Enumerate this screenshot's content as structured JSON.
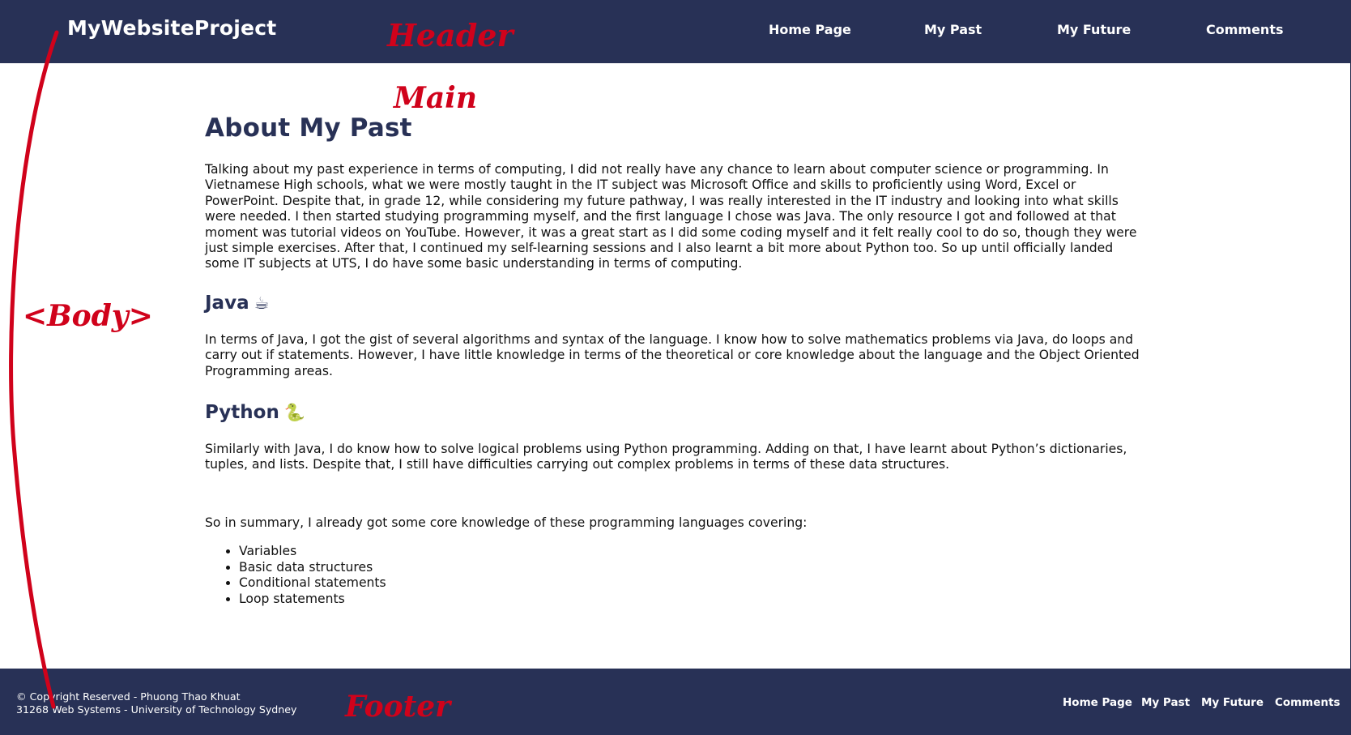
{
  "colors": {
    "header_bg": "#283156",
    "heading": "#283156",
    "annotation": "#d0021b",
    "body_text": "#111111"
  },
  "header": {
    "site_title": "MyWebsiteProject",
    "nav": [
      "Home Page",
      "My Past",
      "My Future",
      "Comments"
    ]
  },
  "main": {
    "title": "About My Past",
    "intro": "Talking about my past experience in terms of computing, I did not really have any chance to learn about computer science or programming. In Vietnamese High schools, what we were mostly taught in the IT subject was Microsoft Office and skills to proficiently using Word, Excel or PowerPoint. Despite that, in grade 12, while considering my future pathway, I was really interested in the IT industry and looking into what skills were needed. I then started studying programming myself, and the first language I chose was Java. The only resource I got and followed at that moment was tutorial videos on YouTube. However, it was a great start as I did some coding myself and it felt really cool to do so, though they were just simple exercises. After that, I continued my self-learning sessions and I also learnt a bit more about Python too. So up until officially landed some IT subjects at UTS, I do have some basic understanding in terms of computing.",
    "java": {
      "heading": "Java",
      "emoji": "☕",
      "text": "In terms of Java, I got the gist of several algorithms and syntax of the language. I know how to solve mathematics problems via Java, do loops and carry out if statements. However, I have little knowledge in terms of the theoretical or core knowledge about the language and the Object Oriented Programming areas."
    },
    "python": {
      "heading": "Python",
      "emoji": "🐍",
      "text": "Similarly with Java, I do know how to solve logical problems using Python programming. Adding on that, I have learnt about Python’s dictionaries, tuples, and lists. Despite that, I still have difficulties carrying out complex problems in terms of these data structures."
    },
    "summary": "So in summary, I already got some core knowledge of these programming languages covering:",
    "list": [
      "Variables",
      "Basic data structures",
      "Conditional statements",
      "Loop statements"
    ]
  },
  "footer": {
    "copyright_line1": "© Copyright Reserved - Phuong Thao Khuat",
    "copyright_line2": "31268 Web Systems - University of Technology Sydney",
    "nav": [
      "Home Page",
      "My Past",
      "My Future",
      "Comments"
    ]
  },
  "annotations": {
    "header": "Header",
    "main": "Main",
    "body": "<Body>",
    "footer": "Footer"
  }
}
